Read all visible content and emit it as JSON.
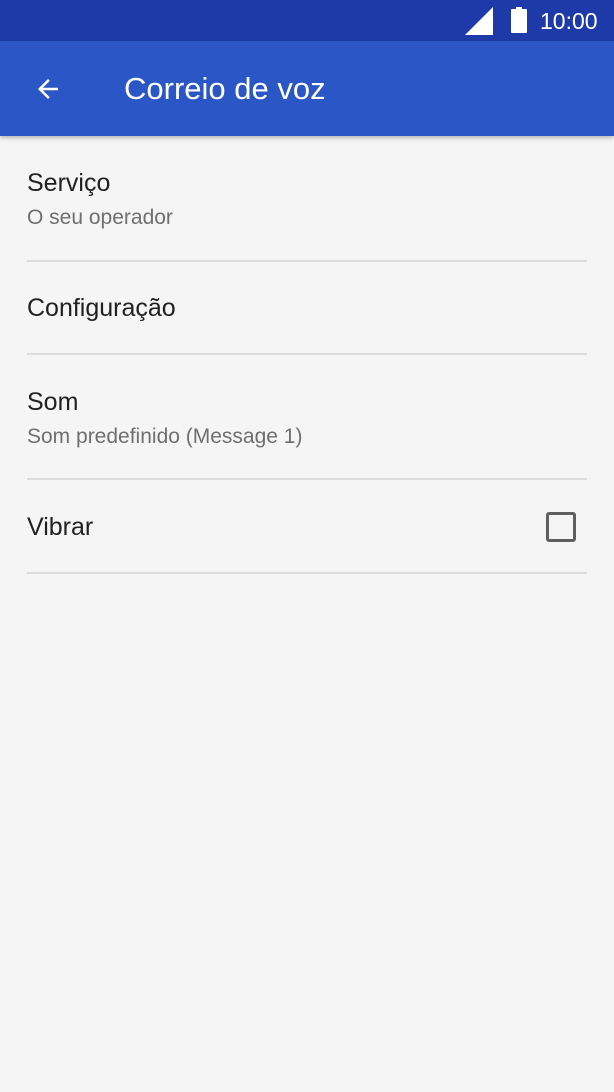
{
  "status_bar": {
    "time": "10:00",
    "icons": [
      "cell-signal-icon",
      "battery-icon"
    ]
  },
  "app_bar": {
    "title": "Correio de voz",
    "back_icon": "arrow-back-icon"
  },
  "settings": {
    "items": [
      {
        "primary": "Serviço",
        "secondary": "O seu operador"
      },
      {
        "primary": "Configuração"
      },
      {
        "primary": "Som",
        "secondary": "Som predefinido (Message 1)"
      },
      {
        "primary": "Vibrar",
        "checked": false
      }
    ]
  },
  "colors": {
    "status_bar": "#1d3aa8",
    "app_bar": "#2a56c6",
    "background": "#f5f5f5",
    "divider": "#dcdcdc",
    "primary_text": "#212121",
    "secondary_text": "#6f6f6f"
  }
}
